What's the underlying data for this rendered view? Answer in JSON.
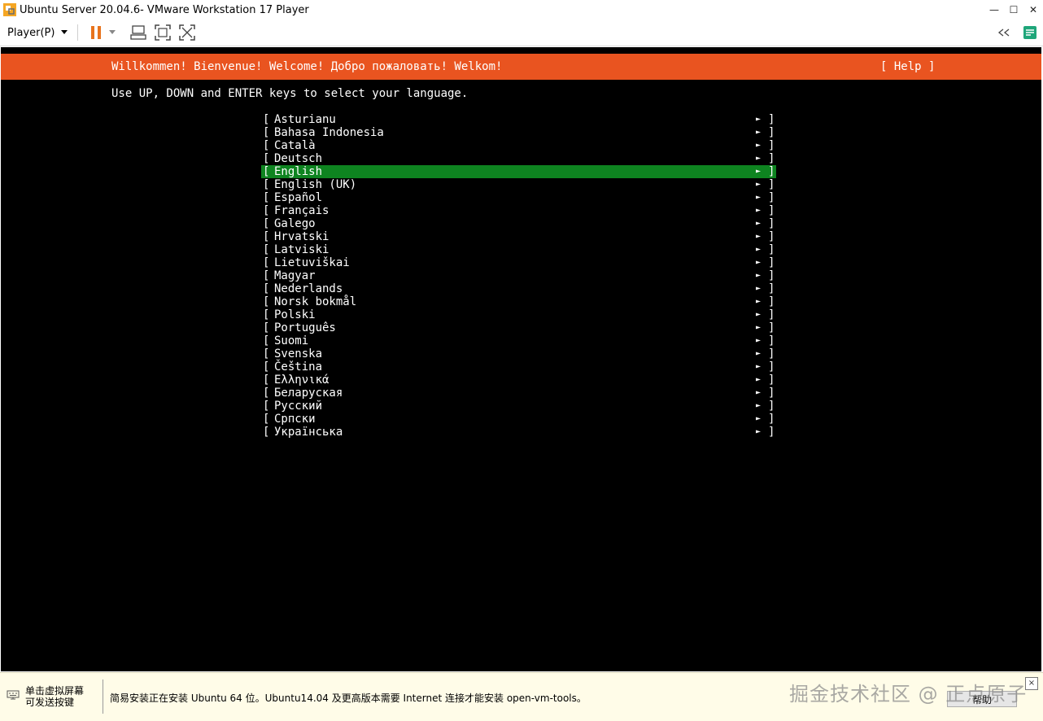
{
  "window": {
    "title": "Ubuntu Server 20.04.6- VMware Workstation 17 Player"
  },
  "window_controls": {
    "minimize": "—",
    "maximize": "☐",
    "close": "✕"
  },
  "toolbar": {
    "player_menu": "Player(P)"
  },
  "installer": {
    "header": "Willkommen! Bienvenue! Welcome! Добро пожаловать! Welkom!",
    "help": "[ Help ]",
    "instructions": "Use UP, DOWN and ENTER keys to select your language.",
    "selected": "English",
    "languages": [
      "Asturianu",
      "Bahasa Indonesia",
      "Català",
      "Deutsch",
      "English",
      "English (UK)",
      "Español",
      "Français",
      "Galego",
      "Hrvatski",
      "Latviski",
      "Lietuviškai",
      "Magyar",
      "Nederlands",
      "Norsk bokmål",
      "Polski",
      "Português",
      "Suomi",
      "Svenska",
      "Čeština",
      "Ελληνικά",
      "Беларуская",
      "Русский",
      "Српски",
      "Українська"
    ],
    "bracket_left": "[",
    "bracket_right": "]",
    "arrow": "►"
  },
  "infobar": {
    "hint": "单击虚拟屏幕\n可发送按键",
    "message": "简易安装正在安装 Ubuntu 64 位。Ubuntu14.04 及更高版本需要 Internet 连接才能安装 open-vm-tools。",
    "help_button": "帮助",
    "watermark": "掘金技术社区 @ 正点原子",
    "close": "×"
  },
  "colors": {
    "ubuntu_orange": "#e95420",
    "selection_green": "#0e8420",
    "pause_orange": "#e8731c"
  }
}
